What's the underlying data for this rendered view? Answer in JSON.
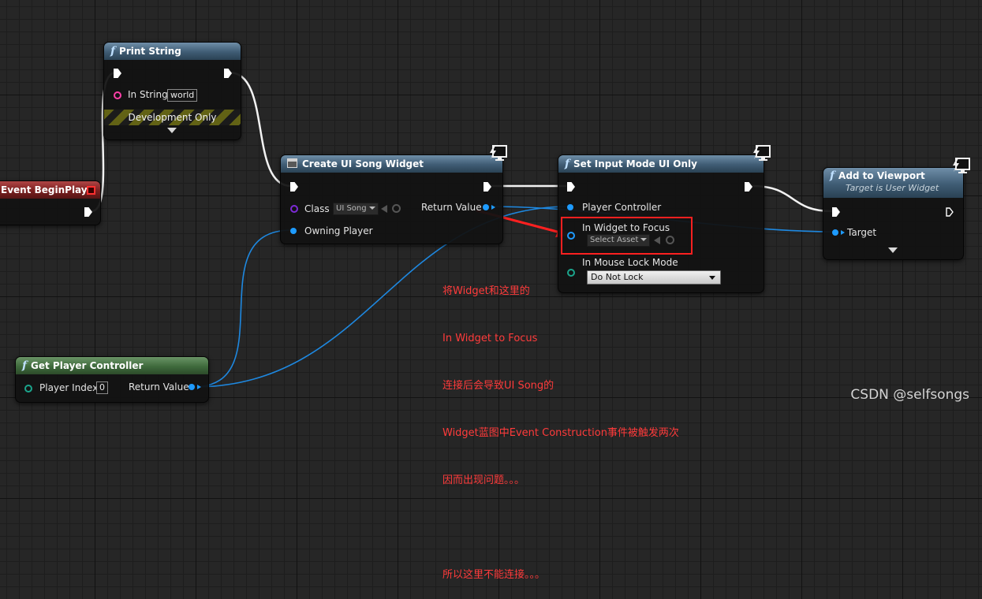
{
  "nodes": {
    "event_begin_play": {
      "title": "Event BeginPlay"
    },
    "print_string": {
      "title": "Print String",
      "in_string_label": "In String",
      "in_string_value": "world",
      "dev_only": "Development Only"
    },
    "create_widget": {
      "title": "Create UI Song Widget",
      "class_label": "Class",
      "class_value": "UI Song",
      "owning_player_label": "Owning Player",
      "return_value_label": "Return Value"
    },
    "set_input_mode": {
      "title": "Set Input Mode UI Only",
      "player_controller_label": "Player Controller",
      "in_widget_label": "In Widget to Focus",
      "in_widget_value": "Select Asset",
      "mouse_lock_label": "In Mouse Lock Mode",
      "mouse_lock_value": "Do Not Lock"
    },
    "add_to_viewport": {
      "title": "Add to Viewport",
      "subtitle": "Target is User Widget",
      "target_label": "Target"
    },
    "get_player_controller": {
      "title": "Get Player Controller",
      "player_index_label": "Player Index",
      "player_index_value": "0",
      "return_value_label": "Return Value"
    }
  },
  "annotation": {
    "lines": [
      "将Widget和这里的",
      "In Widget to Focus",
      "连接后会导致UI Song的",
      "Widget蓝图中Event Construction事件被触发两次",
      "因而出现问题。。。",
      "",
      "所以这里不能连接。。。"
    ]
  },
  "watermark": "CSDN @selfsongs",
  "colors": {
    "exec_wire": "#ffffff",
    "object_wire": "#1e9bff",
    "annotation": "#ff2020"
  },
  "icons": [
    "function-icon",
    "latent-monitor-icon",
    "widget-class-icon",
    "browse-arrow-icon",
    "search-icon",
    "event-delegate-icon"
  ]
}
